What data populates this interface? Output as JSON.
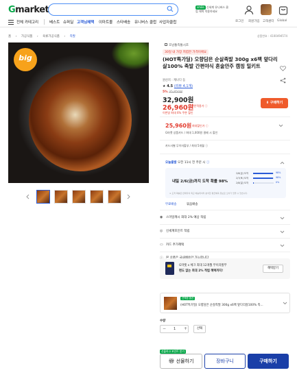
{
  "header": {
    "logo_g": "G",
    "logo_rest": "market",
    "smile_badge": "smile",
    "smile_text": "신세계 유니버스 클럽 해택 적용하세요"
  },
  "nav": {
    "all_categories": "전체 카테고리",
    "items": [
      "베스트",
      "슈퍼딜",
      "고객님혜택",
      "이마트몰",
      "스타배송",
      "유니버스 클럽",
      "사업자클럽"
    ],
    "util": [
      "로그인",
      "회원가입",
      "고객센터",
      "Global"
    ]
  },
  "breadcrumb": [
    "홈",
    "가공식품",
    "육류가공식품",
    "족발"
  ],
  "product_code": "상품번호 : 4100494574",
  "image_badge": "big",
  "seller": "호남통족통시조",
  "promo_tag": "30일 내 가장 저렴한 가격이에요",
  "title": "(HOT특가딜) 오향담은 순살족발 300g x6팩 앞다리살100% 족발 간편야식 혼술안주 캠핑 밀키트",
  "seller_shop": "원산지 : 캐나다 등",
  "rating": "★ 4.5",
  "review_count": "(리뷰 4,1개)",
  "discount1": "5%",
  "orig_price": "35,850원",
  "price": "32,900원",
  "final_price": "26,960원",
  "final_price_note": "쿠폰적용가 ⓘ",
  "coupon_note": "이번달 최대 6% 쿠폰 할인",
  "coupon_button": "구매하기",
  "deal_price": "25,960원",
  "deal_price_note": "최대할인가 ⓘ",
  "deal_sub": "G마켓 상품카드 / 최대 1,000원 결제 시 할인",
  "card_row": "카드사별 무이자할부 / 최대 5개월 ⓘ",
  "ship_label": "오늘출발",
  "ship_text": "오전 11시 전 주문 시",
  "delivery_box_title": "내일 2/6(금)까지 도착 확률 98%",
  "delivery_bars": [
    {
      "label": "2/6(금) 도착",
      "pct": "98%",
      "fill": 0.98
    },
    {
      "label": "2/7(토) 도착",
      "pct": "98%",
      "fill": 0.98
    },
    {
      "label": "2/8(일) 도착",
      "pct": "0%",
      "fill": 0.02
    }
  ],
  "delivery_note": "※ 도착 확률은 판매자의 최근 배송데이터 분석한 평균예측 정보로 오차가 있을 수 있습니다.",
  "ship_fee": "무료배송",
  "ship_option": "묶음배송",
  "rows": [
    "스마일캐시 최대 2% 예상 적립",
    "신세계포인트 적립",
    "카드 추가혜택",
    "본 상품은 국내배송만 가능합니다"
  ],
  "banner_title": "G마켓 x 체크 최대 12개월 무이자할부",
  "banner_sub": "편도 없는 최대 2% 적립 혜택까지!",
  "banner_button": "혜택받기",
  "selected_option_label": "선택한 옵션",
  "selected_option": "(HOT특가딜) 오향담은 순살족발 300g x6팩 앞다리살100% 족...",
  "quantity_label": "수량",
  "quantity_value": "1",
  "quantity_select": "선택",
  "gift_tip": "선물하고 포인트 받기",
  "btn_gift": "선물하기",
  "btn_cart": "장바구니",
  "btn_buy": "구매하기"
}
